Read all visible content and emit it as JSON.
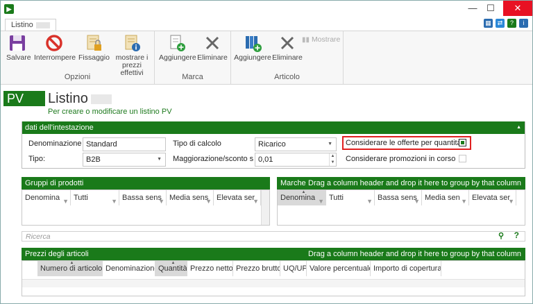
{
  "window": {
    "app_icon": "app-logo-icon",
    "min_glyph": "—",
    "max_glyph": "☐",
    "close_glyph": "✕"
  },
  "tabs": {
    "active_label": "Listino"
  },
  "ribbon": {
    "groups": {
      "opzioni": "Opzioni",
      "marca": "Marca",
      "articolo": "Articolo"
    },
    "buttons": {
      "salvare": "Salvare",
      "interrompere": "Interrompere",
      "fissaggio": "Fissaggio",
      "mostrare_prezzi_1": "mostrare i",
      "mostrare_prezzi_2": "prezzi effettivi",
      "aggiungere_marca": "Aggiungere",
      "eliminare_marca": "Eliminare",
      "aggiungere_articolo": "Aggiungere",
      "eliminare_articolo": "Eliminare",
      "mostrare": "Mostrare"
    }
  },
  "page": {
    "badge": "PV",
    "title": "Listino",
    "subtitle": "Per creare o modificare un listino PV"
  },
  "header_panel": {
    "title": "dati dell'intestazione",
    "denominazione_label": "Denominazione",
    "denominazione_value": "Standard",
    "tipo_label": "Tipo:",
    "tipo_value": "B2B",
    "tipo_calcolo_label": "Tipo di calcolo",
    "tipo_calcolo_value": "Ricarico",
    "maggiorazione_label": "Maggiorazione/sconto stan",
    "maggiorazione_value": "0,01",
    "offerte_label": "Considerare le offerte per quantità",
    "offerte_checked": true,
    "promozioni_label": "Considerare promozioni in corso",
    "promozioni_checked": false
  },
  "gruppi": {
    "title": "Gruppi di prodotti",
    "columns": [
      "Denomina",
      "Tutti",
      "Bassa sens",
      "Media sens",
      "Elevata ser"
    ]
  },
  "marche": {
    "title": "Marche",
    "group_hint": "Drag a column header and drop it here to group by that column",
    "columns": [
      "Denomina",
      "Tutti",
      "Bassa sens",
      "Media sen",
      "Elevata ser"
    ]
  },
  "search": {
    "placeholder": "Ricerca"
  },
  "prezzi": {
    "title": "Prezzi degli articoli",
    "group_hint": "Drag a column header and drop it here to group by that column",
    "columns": [
      "Numero di articolo",
      "Denominazione",
      "Quantità",
      "Prezzo netto",
      "Prezzo brutto",
      "UQ/UP",
      "Valore percentuale",
      "Importo di copertura"
    ]
  },
  "colors": {
    "accent_green": "#1a7a1a",
    "highlight_red": "#e02020",
    "close_red": "#e81123"
  }
}
